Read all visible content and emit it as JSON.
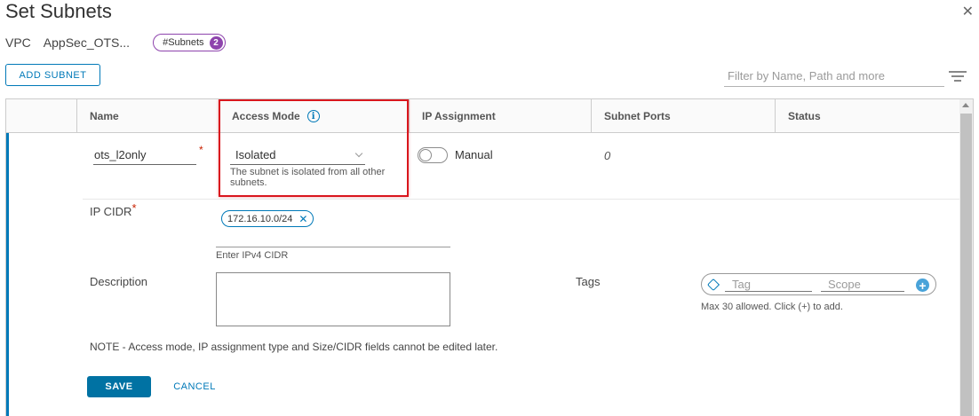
{
  "dialog": {
    "title": "Set Subnets",
    "close_icon": "close-icon"
  },
  "meta": {
    "vpc_label": "VPC",
    "vpc_name": "AppSec_OTS...",
    "subnets_badge_label": "#Subnets",
    "subnets_count": "2"
  },
  "toolbar": {
    "add_subnet_label": "ADD SUBNET",
    "filter_placeholder": "Filter by Name, Path and more",
    "filter_icon": "filter-lines-icon"
  },
  "grid": {
    "columns": [
      "Name",
      "Access Mode",
      "IP Assignment",
      "Subnet Ports",
      "Status"
    ],
    "access_mode_info_icon": "info-icon"
  },
  "row": {
    "name_value": "ots_l2only",
    "access_mode_value": "Isolated",
    "access_mode_help": "The subnet is isolated from all other subnets.",
    "ip_assignment_label": "Manual",
    "subnet_ports_value": "0",
    "colors": {
      "accent": "#0079b8",
      "highlight_border": "#d9161d",
      "required_star": "#c92100"
    }
  },
  "form": {
    "ip_cidr_label": "IP CIDR",
    "required_mark": "*",
    "cidr_chip": "172.16.10.0/24",
    "cidr_chip_remove": "✕",
    "cidr_help": "Enter IPv4 CIDR",
    "description_label": "Description",
    "tags_label": "Tags",
    "tag_placeholder": "Tag",
    "scope_placeholder": "Scope",
    "tags_help": "Max 30 allowed. Click (+) to add.",
    "add_tag_icon": "plus-circle-icon",
    "note": "NOTE - Access mode, IP assignment type and Size/CIDR fields cannot be edited later.",
    "save_label": "SAVE",
    "cancel_label": "CANCEL"
  }
}
